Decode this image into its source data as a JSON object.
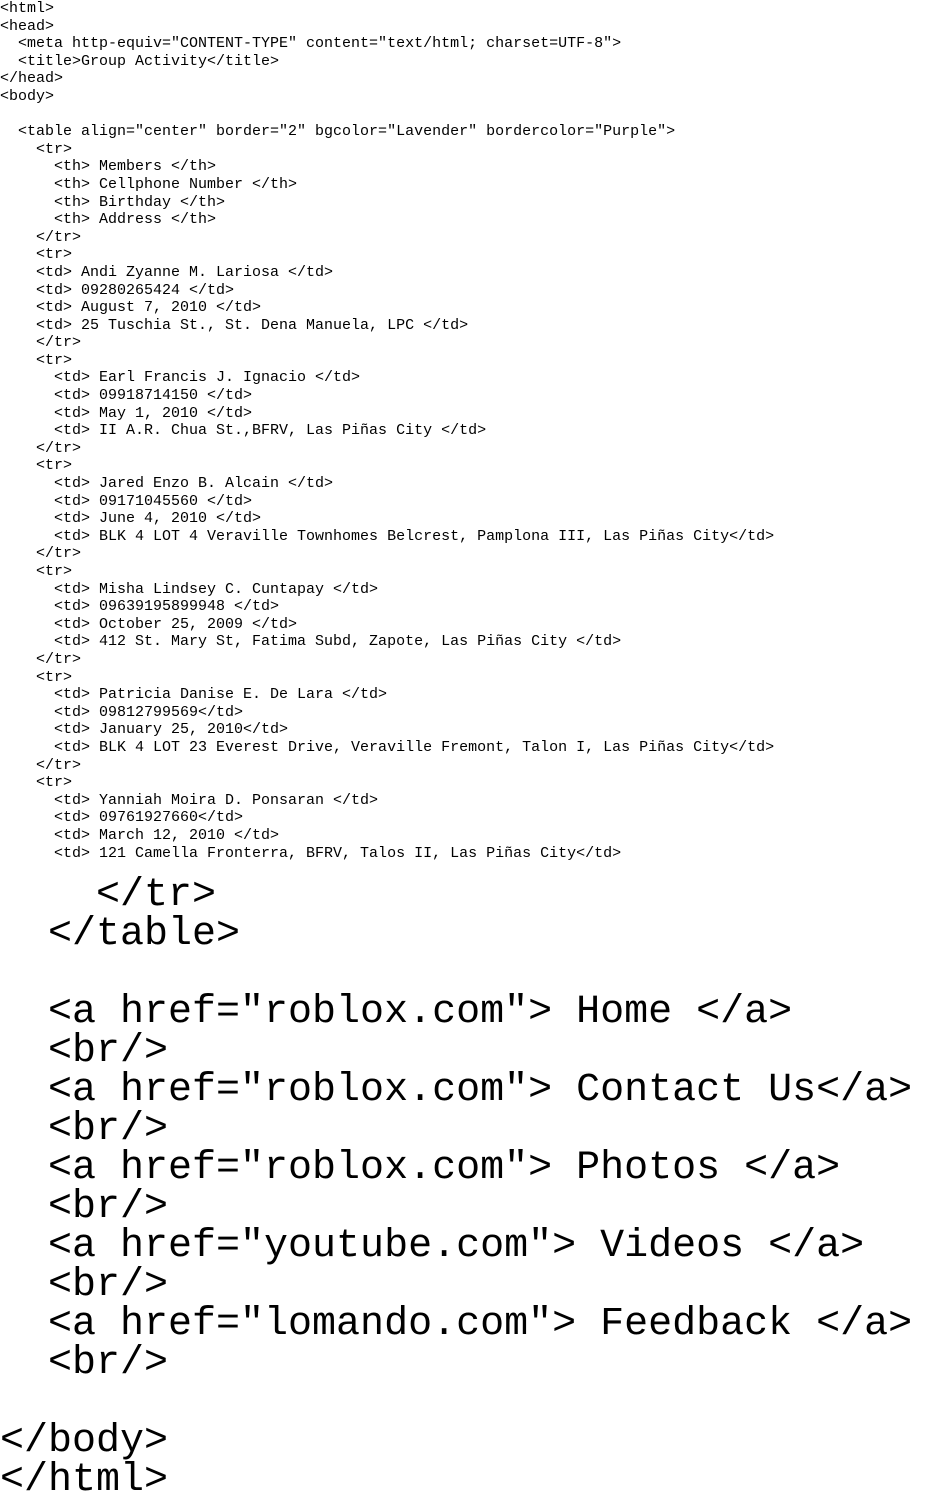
{
  "small_code_lines": [
    "<html>",
    "<head>",
    "  <meta http-equiv=\"CONTENT-TYPE\" content=\"text/html; charset=UTF-8\">",
    "  <title>Group Activity</title>",
    "</head>",
    "<body>",
    "",
    "  <table align=\"center\" border=\"2\" bgcolor=\"Lavender\" bordercolor=\"Purple\">",
    "    <tr>",
    "      <th> Members </th>",
    "      <th> Cellphone Number </th>",
    "      <th> Birthday </th>",
    "      <th> Address </th>",
    "    </tr>",
    "    <tr>",
    "    <td> Andi Zyanne M. Lariosa </td>",
    "    <td> 09280265424 </td>",
    "    <td> August 7, 2010 </td>",
    "    <td> 25 Tuschia St., St. Dena Manuela, LPC </td>",
    "    </tr>",
    "    <tr>",
    "      <td> Earl Francis J. Ignacio </td>",
    "      <td> 09918714150 </td>",
    "      <td> May 1, 2010 </td>",
    "      <td> II A.R. Chua St.,BFRV, Las Piñas City </td>",
    "    </tr>",
    "    <tr>",
    "      <td> Jared Enzo B. Alcain </td>",
    "      <td> 09171045560 </td>",
    "      <td> June 4, 2010 </td>",
    "      <td> BLK 4 LOT 4 Veraville Townhomes Belcrest, Pamplona III, Las Piñas City</td>",
    "    </tr>",
    "    <tr>",
    "      <td> Misha Lindsey C. Cuntapay </td>",
    "      <td> 09639195899948 </td>",
    "      <td> October 25, 2009 </td>",
    "      <td> 412 St. Mary St, Fatima Subd, Zapote, Las Piñas City </td>",
    "    </tr>",
    "    <tr>",
    "      <td> Patricia Danise E. De Lara </td>",
    "      <td> 09812799569</td>",
    "      <td> January 25, 2010</td>",
    "      <td> BLK 4 LOT 23 Everest Drive, Veraville Fremont, Talon I, Las Piñas City</td>",
    "    </tr>",
    "    <tr>",
    "      <td> Yanniah Moira D. Ponsaran </td>",
    "      <td> 09761927660</td>",
    "      <td> March 12, 2010 </td>",
    "      <td> 121 Camella Fronterra, BFRV, Talos II, Las Piñas City</td>"
  ],
  "large_code_lines": [
    "    </tr>",
    "  </table>",
    "",
    "  <a href=\"roblox.com\"> Home </a>",
    "  <br/>",
    "  <a href=\"roblox.com\"> Contact Us</a>",
    "  <br/>",
    "  <a href=\"roblox.com\"> Photos </a>",
    "  <br/>",
    "  <a href=\"youtube.com\"> Videos </a>",
    "  <br/>",
    "  <a href=\"lomando.com\"> Feedback </a>",
    "  <br/>",
    "",
    "</body>",
    "</html>"
  ]
}
